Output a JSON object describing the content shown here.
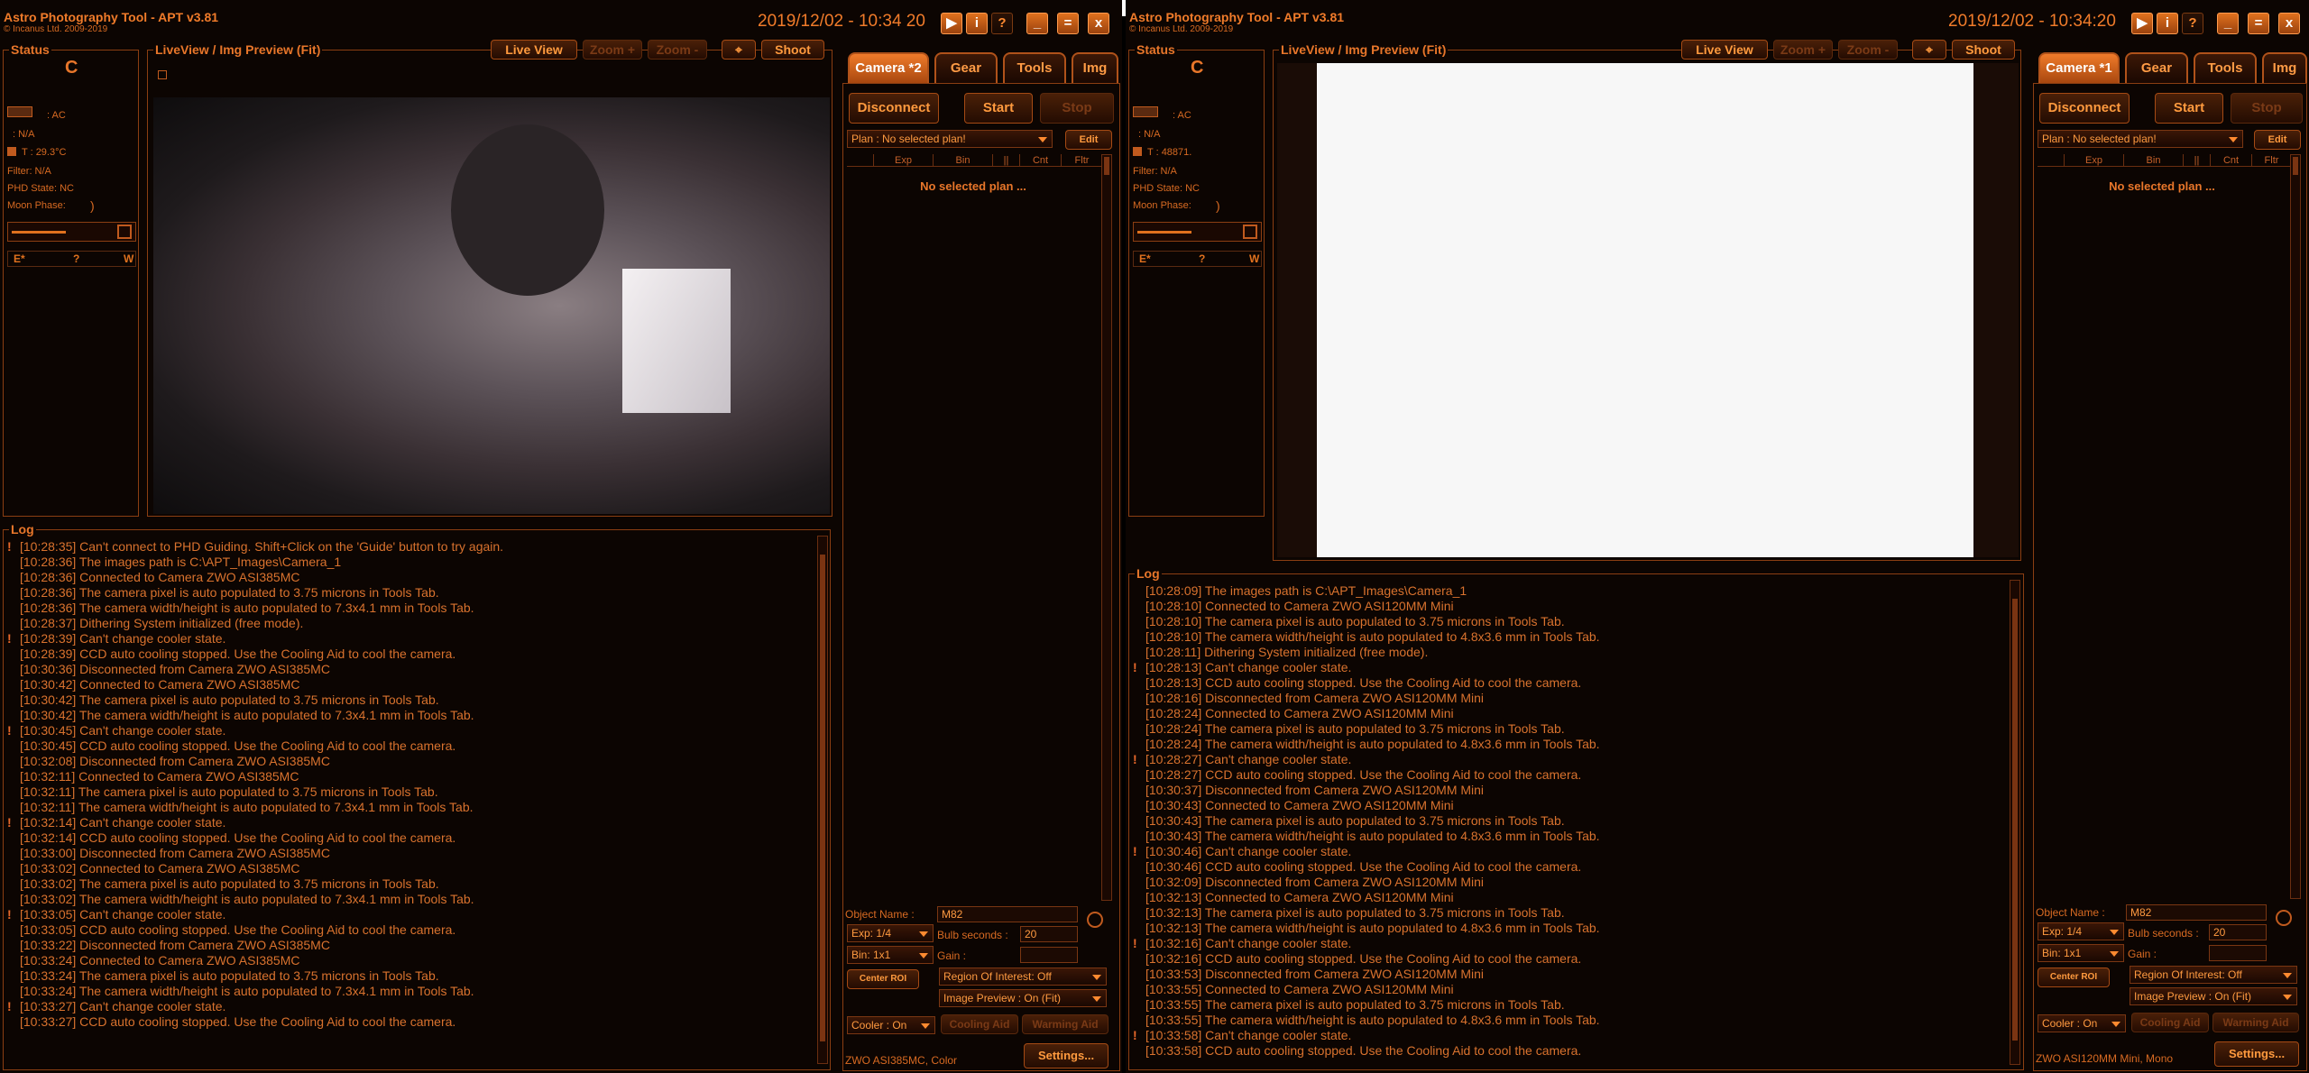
{
  "windows": [
    {
      "title": "Astro Photography Tool  -  APT v3.81",
      "subtitle": "© Incanus Ltd. 2009-2019",
      "datetime": "2019/12/02 - 10:34 20",
      "status": {
        "label": "Status",
        "letter": "C",
        "power": ": AC",
        "power2": ": N/A",
        "temp": "T : 29.3°C",
        "filter": "Filter: N/A",
        "phd": "PHD State: NC",
        "moon": "Moon Phase:",
        "moon_glyph": ")",
        "compass": [
          "E*",
          "?",
          "W"
        ]
      },
      "liveview": {
        "label": "LiveView / Img Preview (Fit)",
        "buttons": [
          "Live View",
          "Zoom +",
          "Zoom -",
          "⌖",
          "Shoot"
        ]
      },
      "tabs": [
        "Camera *2",
        "Gear",
        "Tools",
        "Img"
      ],
      "camera": {
        "disconnect": "Disconnect",
        "start": "Start",
        "stop": "Stop",
        "plan": "Plan : No selected plan!",
        "edit": "Edit",
        "columns": [
          "Exp",
          "Bin",
          "||",
          "Cnt",
          "Fltr"
        ],
        "no_plan": "No selected plan ...",
        "object_label": "Object Name :",
        "object_value": "M82",
        "exp": "Exp: 1/4",
        "bulb_label": "Bulb seconds :",
        "bulb_value": "20",
        "bin": "Bin: 1x1",
        "gain_label": "Gain :",
        "center_roi": "Center ROI",
        "roi": "Region Of Interest: Off",
        "preview": "Image Preview : On (Fit)",
        "cooler": "Cooler : On",
        "cooling_aid": "Cooling Aid",
        "warming_aid": "Warming Aid",
        "camera_name": "ZWO ASI385MC, Color",
        "settings": "Settings..."
      },
      "log": {
        "label": "Log",
        "lines": [
          {
            "bang": "!",
            "text": "[10:28:35] Can't connect to PHD Guiding. Shift+Click on the 'Guide' button to try again."
          },
          {
            "bang": "",
            "text": "[10:28:36] The images path is C:\\APT_Images\\Camera_1"
          },
          {
            "bang": "",
            "text": "[10:28:36] Connected to Camera ZWO ASI385MC"
          },
          {
            "bang": "",
            "text": "[10:28:36] The camera pixel is auto populated to 3.75 microns in Tools Tab."
          },
          {
            "bang": "",
            "text": "[10:28:36] The camera width/height is auto populated to 7.3x4.1 mm in Tools Tab."
          },
          {
            "bang": "",
            "text": "[10:28:37] Dithering System initialized (free mode)."
          },
          {
            "bang": "!",
            "text": "[10:28:39] Can't change cooler state."
          },
          {
            "bang": "",
            "text": "[10:28:39] CCD auto cooling stopped. Use the Cooling Aid to cool the camera."
          },
          {
            "bang": "",
            "text": "[10:30:36] Disconnected from Camera ZWO ASI385MC"
          },
          {
            "bang": "",
            "text": "[10:30:42] Connected to Camera ZWO ASI385MC"
          },
          {
            "bang": "",
            "text": "[10:30:42] The camera pixel is auto populated to 3.75 microns in Tools Tab."
          },
          {
            "bang": "",
            "text": "[10:30:42] The camera width/height is auto populated to 7.3x4.1 mm in Tools Tab."
          },
          {
            "bang": "!",
            "text": "[10:30:45] Can't change cooler state."
          },
          {
            "bang": "",
            "text": "[10:30:45] CCD auto cooling stopped. Use the Cooling Aid to cool the camera."
          },
          {
            "bang": "",
            "text": "[10:32:08] Disconnected from Camera ZWO ASI385MC"
          },
          {
            "bang": "",
            "text": "[10:32:11] Connected to Camera ZWO ASI385MC"
          },
          {
            "bang": "",
            "text": "[10:32:11] The camera pixel is auto populated to 3.75 microns in Tools Tab."
          },
          {
            "bang": "",
            "text": "[10:32:11] The camera width/height is auto populated to 7.3x4.1 mm in Tools Tab."
          },
          {
            "bang": "!",
            "text": "[10:32:14] Can't change cooler state."
          },
          {
            "bang": "",
            "text": "[10:32:14] CCD auto cooling stopped. Use the Cooling Aid to cool the camera."
          },
          {
            "bang": "",
            "text": "[10:33:00] Disconnected from Camera ZWO ASI385MC"
          },
          {
            "bang": "",
            "text": "[10:33:02] Connected to Camera ZWO ASI385MC"
          },
          {
            "bang": "",
            "text": "[10:33:02] The camera pixel is auto populated to 3.75 microns in Tools Tab."
          },
          {
            "bang": "",
            "text": "[10:33:02] The camera width/height is auto populated to 7.3x4.1 mm in Tools Tab."
          },
          {
            "bang": "!",
            "text": "[10:33:05] Can't change cooler state."
          },
          {
            "bang": "",
            "text": "[10:33:05] CCD auto cooling stopped. Use the Cooling Aid to cool the camera."
          },
          {
            "bang": "",
            "text": "[10:33:22] Disconnected from Camera ZWO ASI385MC"
          },
          {
            "bang": "",
            "text": "[10:33:24] Connected to Camera ZWO ASI385MC"
          },
          {
            "bang": "",
            "text": "[10:33:24] The camera pixel is auto populated to 3.75 microns in Tools Tab."
          },
          {
            "bang": "",
            "text": "[10:33:24] The camera width/height is auto populated to 7.3x4.1 mm in Tools Tab."
          },
          {
            "bang": "!",
            "text": "[10:33:27] Can't change cooler state."
          },
          {
            "bang": "",
            "text": "[10:33:27] CCD auto cooling stopped. Use the Cooling Aid to cool the camera."
          }
        ]
      }
    },
    {
      "title": "Astro Photography Tool  -  APT v3.81",
      "subtitle": "© Incanus Ltd. 2009-2019",
      "datetime": "2019/12/02 - 10:34:20",
      "status": {
        "label": "Status",
        "letter": "C",
        "power": ": AC",
        "power2": ": N/A",
        "temp": "T : 48871.",
        "filter": "Filter: N/A",
        "phd": "PHD State: NC",
        "moon": "Moon Phase:",
        "moon_glyph": ")",
        "compass": [
          "E*",
          "?",
          "W"
        ]
      },
      "liveview": {
        "label": "LiveView / Img Preview (Fit)",
        "buttons": [
          "Live View",
          "Zoom +",
          "Zoom -",
          "⌖",
          "Shoot"
        ]
      },
      "tabs": [
        "Camera *1",
        "Gear",
        "Tools",
        "Img"
      ],
      "camera": {
        "disconnect": "Disconnect",
        "start": "Start",
        "stop": "Stop",
        "plan": "Plan : No selected plan!",
        "edit": "Edit",
        "columns": [
          "Exp",
          "Bin",
          "||",
          "Cnt",
          "Fltr"
        ],
        "no_plan": "No selected plan ...",
        "object_label": "Object Name :",
        "object_value": "M82",
        "exp": "Exp: 1/4",
        "bulb_label": "Bulb seconds :",
        "bulb_value": "20",
        "bin": "Bin: 1x1",
        "gain_label": "Gain :",
        "center_roi": "Center ROI",
        "roi": "Region Of Interest: Off",
        "preview": "Image Preview : On (Fit)",
        "cooler": "Cooler : On",
        "cooling_aid": "Cooling Aid",
        "warming_aid": "Warming Aid",
        "camera_name": "ZWO ASI120MM Mini, Mono",
        "settings": "Settings..."
      },
      "log": {
        "label": "Log",
        "lines": [
          {
            "bang": "",
            "text": "[10:28:09] The images path is C:\\APT_Images\\Camera_1"
          },
          {
            "bang": "",
            "text": "[10:28:10] Connected to Camera ZWO ASI120MM Mini"
          },
          {
            "bang": "",
            "text": "[10:28:10] The camera pixel is auto populated to 3.75 microns in Tools Tab."
          },
          {
            "bang": "",
            "text": "[10:28:10] The camera width/height is auto populated to 4.8x3.6 mm in Tools Tab."
          },
          {
            "bang": "",
            "text": "[10:28:11] Dithering System initialized (free mode)."
          },
          {
            "bang": "!",
            "text": "[10:28:13] Can't change cooler state."
          },
          {
            "bang": "",
            "text": "[10:28:13] CCD auto cooling stopped. Use the Cooling Aid to cool the camera."
          },
          {
            "bang": "",
            "text": "[10:28:16] Disconnected from Camera ZWO ASI120MM Mini"
          },
          {
            "bang": "",
            "text": "[10:28:24] Connected to Camera ZWO ASI120MM Mini"
          },
          {
            "bang": "",
            "text": "[10:28:24] The camera pixel is auto populated to 3.75 microns in Tools Tab."
          },
          {
            "bang": "",
            "text": "[10:28:24] The camera width/height is auto populated to 4.8x3.6 mm in Tools Tab."
          },
          {
            "bang": "!",
            "text": "[10:28:27] Can't change cooler state."
          },
          {
            "bang": "",
            "text": "[10:28:27] CCD auto cooling stopped. Use the Cooling Aid to cool the camera."
          },
          {
            "bang": "",
            "text": "[10:30:37] Disconnected from Camera ZWO ASI120MM Mini"
          },
          {
            "bang": "",
            "text": "[10:30:43] Connected to Camera ZWO ASI120MM Mini"
          },
          {
            "bang": "",
            "text": "[10:30:43] The camera pixel is auto populated to 3.75 microns in Tools Tab."
          },
          {
            "bang": "",
            "text": "[10:30:43] The camera width/height is auto populated to 4.8x3.6 mm in Tools Tab."
          },
          {
            "bang": "!",
            "text": "[10:30:46] Can't change cooler state."
          },
          {
            "bang": "",
            "text": "[10:30:46] CCD auto cooling stopped. Use the Cooling Aid to cool the camera."
          },
          {
            "bang": "",
            "text": "[10:32:09] Disconnected from Camera ZWO ASI120MM Mini"
          },
          {
            "bang": "",
            "text": "[10:32:13] Connected to Camera ZWO ASI120MM Mini"
          },
          {
            "bang": "",
            "text": "[10:32:13] The camera pixel is auto populated to 3.75 microns in Tools Tab."
          },
          {
            "bang": "",
            "text": "[10:32:13] The camera width/height is auto populated to 4.8x3.6 mm in Tools Tab."
          },
          {
            "bang": "!",
            "text": "[10:32:16] Can't change cooler state."
          },
          {
            "bang": "",
            "text": "[10:32:16] CCD auto cooling stopped. Use the Cooling Aid to cool the camera."
          },
          {
            "bang": "",
            "text": "[10:33:53] Disconnected from Camera ZWO ASI120MM Mini"
          },
          {
            "bang": "",
            "text": "[10:33:55] Connected to Camera ZWO ASI120MM Mini"
          },
          {
            "bang": "",
            "text": "[10:33:55] The camera pixel is auto populated to 3.75 microns in Tools Tab."
          },
          {
            "bang": "",
            "text": "[10:33:55] The camera width/height is auto populated to 4.8x3.6 mm in Tools Tab."
          },
          {
            "bang": "!",
            "text": "[10:33:58] Can't change cooler state."
          },
          {
            "bang": "",
            "text": "[10:33:58] CCD auto cooling stopped. Use the Cooling Aid to cool the camera."
          }
        ]
      }
    }
  ],
  "icons": {
    "play": "play-icon",
    "info": "info-icon",
    "help": "help-icon",
    "minimize": "minimize-icon",
    "maximize": "maximize-icon",
    "close": "close-icon"
  },
  "colors": {
    "accent": "#f07b2a",
    "background": "#0c0502",
    "text": "#d9722e"
  }
}
